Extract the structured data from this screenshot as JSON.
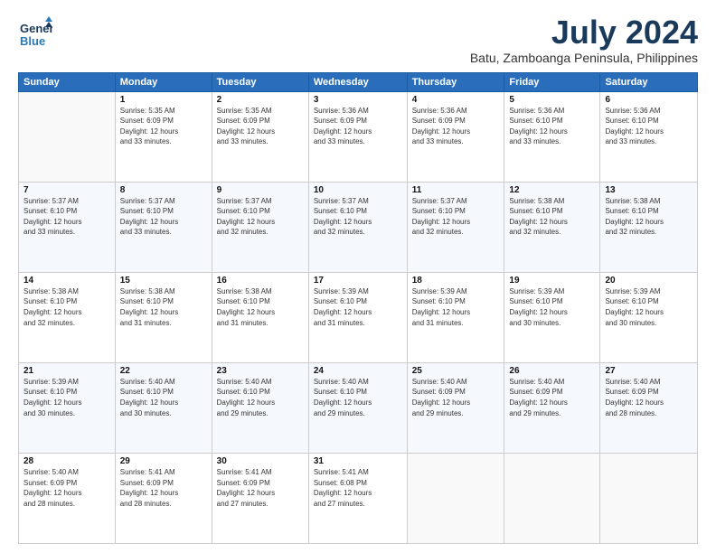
{
  "header": {
    "logo_line1": "General",
    "logo_line2": "Blue",
    "month": "July 2024",
    "location": "Batu, Zamboanga Peninsula, Philippines"
  },
  "days_of_week": [
    "Sunday",
    "Monday",
    "Tuesday",
    "Wednesday",
    "Thursday",
    "Friday",
    "Saturday"
  ],
  "weeks": [
    [
      {
        "day": "",
        "info": ""
      },
      {
        "day": "1",
        "info": "Sunrise: 5:35 AM\nSunset: 6:09 PM\nDaylight: 12 hours\nand 33 minutes."
      },
      {
        "day": "2",
        "info": "Sunrise: 5:35 AM\nSunset: 6:09 PM\nDaylight: 12 hours\nand 33 minutes."
      },
      {
        "day": "3",
        "info": "Sunrise: 5:36 AM\nSunset: 6:09 PM\nDaylight: 12 hours\nand 33 minutes."
      },
      {
        "day": "4",
        "info": "Sunrise: 5:36 AM\nSunset: 6:09 PM\nDaylight: 12 hours\nand 33 minutes."
      },
      {
        "day": "5",
        "info": "Sunrise: 5:36 AM\nSunset: 6:10 PM\nDaylight: 12 hours\nand 33 minutes."
      },
      {
        "day": "6",
        "info": "Sunrise: 5:36 AM\nSunset: 6:10 PM\nDaylight: 12 hours\nand 33 minutes."
      }
    ],
    [
      {
        "day": "7",
        "info": ""
      },
      {
        "day": "8",
        "info": "Sunrise: 5:37 AM\nSunset: 6:10 PM\nDaylight: 12 hours\nand 33 minutes."
      },
      {
        "day": "9",
        "info": "Sunrise: 5:37 AM\nSunset: 6:10 PM\nDaylight: 12 hours\nand 32 minutes."
      },
      {
        "day": "10",
        "info": "Sunrise: 5:37 AM\nSunset: 6:10 PM\nDaylight: 12 hours\nand 32 minutes."
      },
      {
        "day": "11",
        "info": "Sunrise: 5:37 AM\nSunset: 6:10 PM\nDaylight: 12 hours\nand 32 minutes."
      },
      {
        "day": "12",
        "info": "Sunrise: 5:38 AM\nSunset: 6:10 PM\nDaylight: 12 hours\nand 32 minutes."
      },
      {
        "day": "13",
        "info": "Sunrise: 5:38 AM\nSunset: 6:10 PM\nDaylight: 12 hours\nand 32 minutes."
      }
    ],
    [
      {
        "day": "14",
        "info": ""
      },
      {
        "day": "15",
        "info": "Sunrise: 5:38 AM\nSunset: 6:10 PM\nDaylight: 12 hours\nand 31 minutes."
      },
      {
        "day": "16",
        "info": "Sunrise: 5:38 AM\nSunset: 6:10 PM\nDaylight: 12 hours\nand 31 minutes."
      },
      {
        "day": "17",
        "info": "Sunrise: 5:39 AM\nSunset: 6:10 PM\nDaylight: 12 hours\nand 31 minutes."
      },
      {
        "day": "18",
        "info": "Sunrise: 5:39 AM\nSunset: 6:10 PM\nDaylight: 12 hours\nand 31 minutes."
      },
      {
        "day": "19",
        "info": "Sunrise: 5:39 AM\nSunset: 6:10 PM\nDaylight: 12 hours\nand 30 minutes."
      },
      {
        "day": "20",
        "info": "Sunrise: 5:39 AM\nSunset: 6:10 PM\nDaylight: 12 hours\nand 30 minutes."
      }
    ],
    [
      {
        "day": "21",
        "info": ""
      },
      {
        "day": "22",
        "info": "Sunrise: 5:40 AM\nSunset: 6:10 PM\nDaylight: 12 hours\nand 30 minutes."
      },
      {
        "day": "23",
        "info": "Sunrise: 5:40 AM\nSunset: 6:10 PM\nDaylight: 12 hours\nand 29 minutes."
      },
      {
        "day": "24",
        "info": "Sunrise: 5:40 AM\nSunset: 6:10 PM\nDaylight: 12 hours\nand 29 minutes."
      },
      {
        "day": "25",
        "info": "Sunrise: 5:40 AM\nSunset: 6:09 PM\nDaylight: 12 hours\nand 29 minutes."
      },
      {
        "day": "26",
        "info": "Sunrise: 5:40 AM\nSunset: 6:09 PM\nDaylight: 12 hours\nand 29 minutes."
      },
      {
        "day": "27",
        "info": "Sunrise: 5:40 AM\nSunset: 6:09 PM\nDaylight: 12 hours\nand 28 minutes."
      }
    ],
    [
      {
        "day": "28",
        "info": "Sunrise: 5:40 AM\nSunset: 6:09 PM\nDaylight: 12 hours\nand 28 minutes."
      },
      {
        "day": "29",
        "info": "Sunrise: 5:41 AM\nSunset: 6:09 PM\nDaylight: 12 hours\nand 28 minutes."
      },
      {
        "day": "30",
        "info": "Sunrise: 5:41 AM\nSunset: 6:09 PM\nDaylight: 12 hours\nand 27 minutes."
      },
      {
        "day": "31",
        "info": "Sunrise: 5:41 AM\nSunset: 6:08 PM\nDaylight: 12 hours\nand 27 minutes."
      },
      {
        "day": "",
        "info": ""
      },
      {
        "day": "",
        "info": ""
      },
      {
        "day": "",
        "info": ""
      }
    ]
  ],
  "week7_sun": "Sunrise: 5:37 AM\nSunset: 6:10 PM\nDaylight: 12 hours\nand 33 minutes.",
  "week14_sun": "Sunrise: 5:38 AM\nSunset: 6:10 PM\nDaylight: 12 hours\nand 32 minutes.",
  "week21_sun": "Sunrise: 5:39 AM\nSunset: 6:10 PM\nDaylight: 12 hours\nand 30 minutes."
}
